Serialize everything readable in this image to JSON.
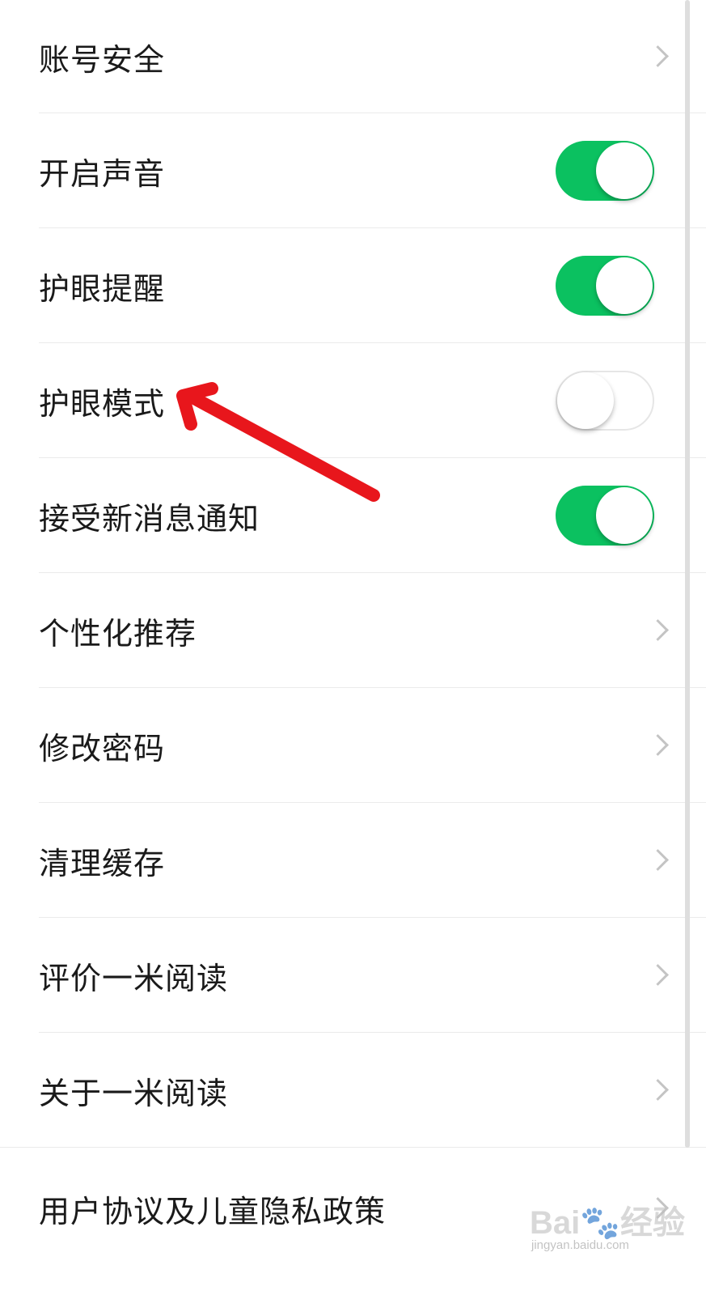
{
  "settings": {
    "items": [
      {
        "label": "账号安全",
        "control": "chevron"
      },
      {
        "label": "开启声音",
        "control": "toggle",
        "on": true
      },
      {
        "label": "护眼提醒",
        "control": "toggle",
        "on": true
      },
      {
        "label": "护眼模式",
        "control": "toggle",
        "on": false
      },
      {
        "label": "接受新消息通知",
        "control": "toggle",
        "on": true
      },
      {
        "label": "个性化推荐",
        "control": "chevron"
      },
      {
        "label": "修改密码",
        "control": "chevron"
      },
      {
        "label": "清理缓存",
        "control": "chevron"
      },
      {
        "label": "评价一米阅读",
        "control": "chevron"
      },
      {
        "label": "关于一米阅读",
        "control": "chevron"
      },
      {
        "label": "用户协议及儿童隐私政策",
        "control": "chevron"
      }
    ]
  },
  "colors": {
    "toggle_on": "#0bc160",
    "annotation_arrow": "#e8161c"
  },
  "icons": {
    "chevron": "chevron-right-icon",
    "annotation": "red-arrow-icon",
    "watermark": "baidu-paw-icon"
  },
  "watermark": {
    "logo_text": "Bai🐾经验",
    "url": "jingyan.baidu.com"
  }
}
